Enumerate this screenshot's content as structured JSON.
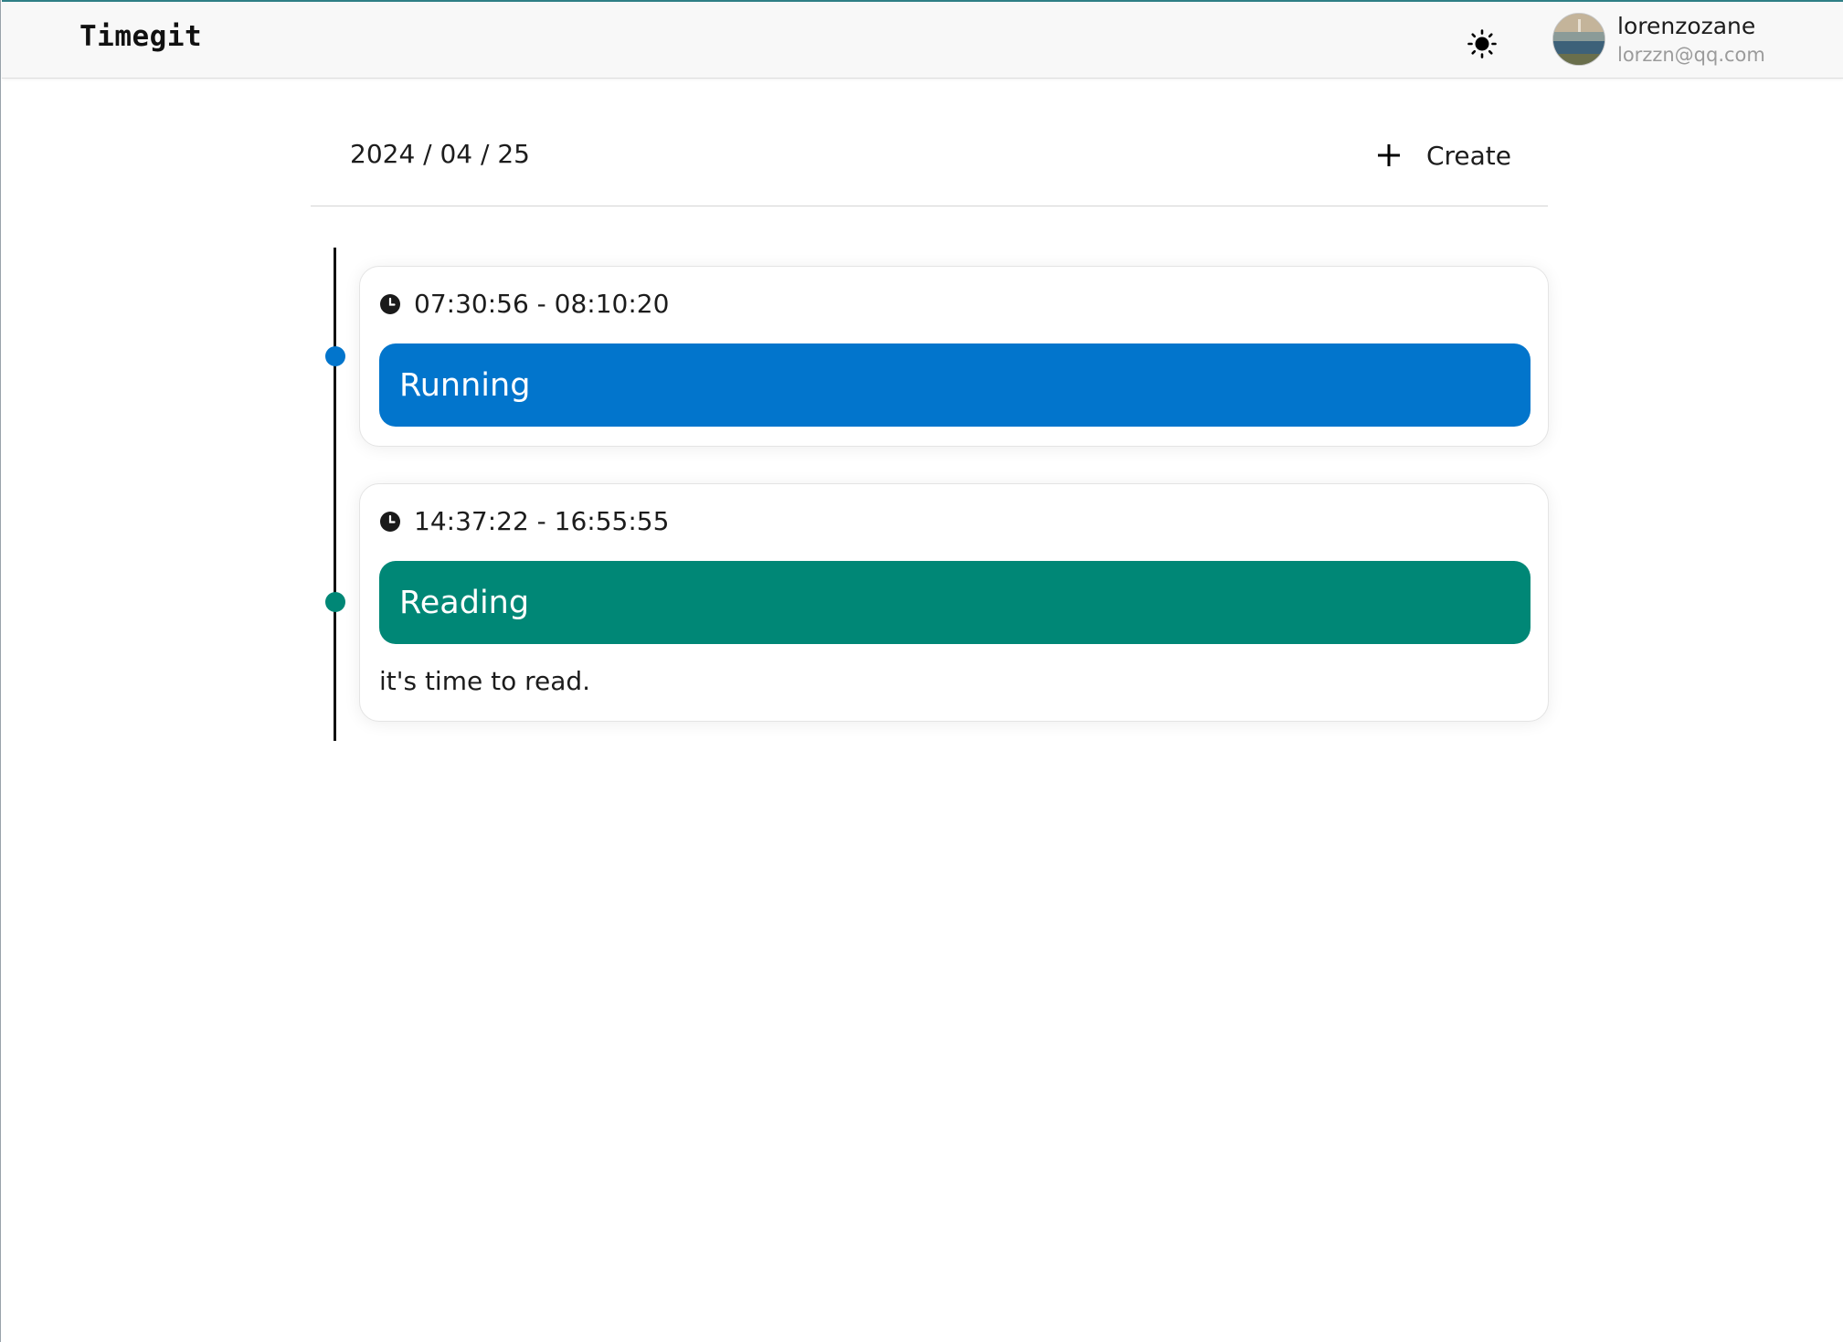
{
  "header": {
    "brand": "Timegit",
    "theme_icon": "sun-icon",
    "user": {
      "name": "lorenzozane",
      "email": "lorzzn@qq.com"
    }
  },
  "toolbar": {
    "date": "2024 / 04 / 25",
    "create_icon": "plus-icon",
    "create_label": "Create"
  },
  "entries": [
    {
      "time": "07:30:56 - 08:10:20",
      "tag": "Running",
      "color": "#0275cc",
      "note": ""
    },
    {
      "time": "14:37:22 - 16:55:55",
      "tag": "Reading",
      "color": "#008776",
      "note": "it's time to read."
    }
  ],
  "colors": {
    "accent_blue": "#0275cc",
    "accent_teal": "#008776",
    "header_bg": "#f8f8f8"
  }
}
